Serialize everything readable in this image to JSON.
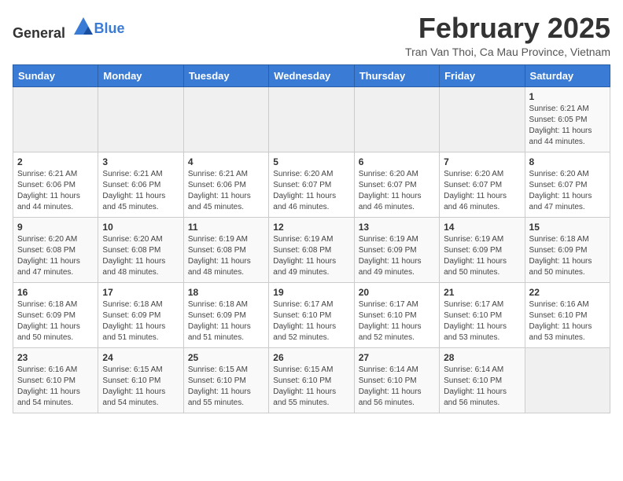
{
  "header": {
    "logo_general": "General",
    "logo_blue": "Blue",
    "title": "February 2025",
    "subtitle": "Tran Van Thoi, Ca Mau Province, Vietnam"
  },
  "days_of_week": [
    "Sunday",
    "Monday",
    "Tuesday",
    "Wednesday",
    "Thursday",
    "Friday",
    "Saturday"
  ],
  "weeks": [
    [
      {
        "day": "",
        "info": ""
      },
      {
        "day": "",
        "info": ""
      },
      {
        "day": "",
        "info": ""
      },
      {
        "day": "",
        "info": ""
      },
      {
        "day": "",
        "info": ""
      },
      {
        "day": "",
        "info": ""
      },
      {
        "day": "1",
        "info": "Sunrise: 6:21 AM\nSunset: 6:05 PM\nDaylight: 11 hours\nand 44 minutes."
      }
    ],
    [
      {
        "day": "2",
        "info": "Sunrise: 6:21 AM\nSunset: 6:06 PM\nDaylight: 11 hours\nand 44 minutes."
      },
      {
        "day": "3",
        "info": "Sunrise: 6:21 AM\nSunset: 6:06 PM\nDaylight: 11 hours\nand 45 minutes."
      },
      {
        "day": "4",
        "info": "Sunrise: 6:21 AM\nSunset: 6:06 PM\nDaylight: 11 hours\nand 45 minutes."
      },
      {
        "day": "5",
        "info": "Sunrise: 6:20 AM\nSunset: 6:07 PM\nDaylight: 11 hours\nand 46 minutes."
      },
      {
        "day": "6",
        "info": "Sunrise: 6:20 AM\nSunset: 6:07 PM\nDaylight: 11 hours\nand 46 minutes."
      },
      {
        "day": "7",
        "info": "Sunrise: 6:20 AM\nSunset: 6:07 PM\nDaylight: 11 hours\nand 46 minutes."
      },
      {
        "day": "8",
        "info": "Sunrise: 6:20 AM\nSunset: 6:07 PM\nDaylight: 11 hours\nand 47 minutes."
      }
    ],
    [
      {
        "day": "9",
        "info": "Sunrise: 6:20 AM\nSunset: 6:08 PM\nDaylight: 11 hours\nand 47 minutes."
      },
      {
        "day": "10",
        "info": "Sunrise: 6:20 AM\nSunset: 6:08 PM\nDaylight: 11 hours\nand 48 minutes."
      },
      {
        "day": "11",
        "info": "Sunrise: 6:19 AM\nSunset: 6:08 PM\nDaylight: 11 hours\nand 48 minutes."
      },
      {
        "day": "12",
        "info": "Sunrise: 6:19 AM\nSunset: 6:08 PM\nDaylight: 11 hours\nand 49 minutes."
      },
      {
        "day": "13",
        "info": "Sunrise: 6:19 AM\nSunset: 6:09 PM\nDaylight: 11 hours\nand 49 minutes."
      },
      {
        "day": "14",
        "info": "Sunrise: 6:19 AM\nSunset: 6:09 PM\nDaylight: 11 hours\nand 50 minutes."
      },
      {
        "day": "15",
        "info": "Sunrise: 6:18 AM\nSunset: 6:09 PM\nDaylight: 11 hours\nand 50 minutes."
      }
    ],
    [
      {
        "day": "16",
        "info": "Sunrise: 6:18 AM\nSunset: 6:09 PM\nDaylight: 11 hours\nand 50 minutes."
      },
      {
        "day": "17",
        "info": "Sunrise: 6:18 AM\nSunset: 6:09 PM\nDaylight: 11 hours\nand 51 minutes."
      },
      {
        "day": "18",
        "info": "Sunrise: 6:18 AM\nSunset: 6:09 PM\nDaylight: 11 hours\nand 51 minutes."
      },
      {
        "day": "19",
        "info": "Sunrise: 6:17 AM\nSunset: 6:10 PM\nDaylight: 11 hours\nand 52 minutes."
      },
      {
        "day": "20",
        "info": "Sunrise: 6:17 AM\nSunset: 6:10 PM\nDaylight: 11 hours\nand 52 minutes."
      },
      {
        "day": "21",
        "info": "Sunrise: 6:17 AM\nSunset: 6:10 PM\nDaylight: 11 hours\nand 53 minutes."
      },
      {
        "day": "22",
        "info": "Sunrise: 6:16 AM\nSunset: 6:10 PM\nDaylight: 11 hours\nand 53 minutes."
      }
    ],
    [
      {
        "day": "23",
        "info": "Sunrise: 6:16 AM\nSunset: 6:10 PM\nDaylight: 11 hours\nand 54 minutes."
      },
      {
        "day": "24",
        "info": "Sunrise: 6:15 AM\nSunset: 6:10 PM\nDaylight: 11 hours\nand 54 minutes."
      },
      {
        "day": "25",
        "info": "Sunrise: 6:15 AM\nSunset: 6:10 PM\nDaylight: 11 hours\nand 55 minutes."
      },
      {
        "day": "26",
        "info": "Sunrise: 6:15 AM\nSunset: 6:10 PM\nDaylight: 11 hours\nand 55 minutes."
      },
      {
        "day": "27",
        "info": "Sunrise: 6:14 AM\nSunset: 6:10 PM\nDaylight: 11 hours\nand 56 minutes."
      },
      {
        "day": "28",
        "info": "Sunrise: 6:14 AM\nSunset: 6:10 PM\nDaylight: 11 hours\nand 56 minutes."
      },
      {
        "day": "",
        "info": ""
      }
    ]
  ]
}
